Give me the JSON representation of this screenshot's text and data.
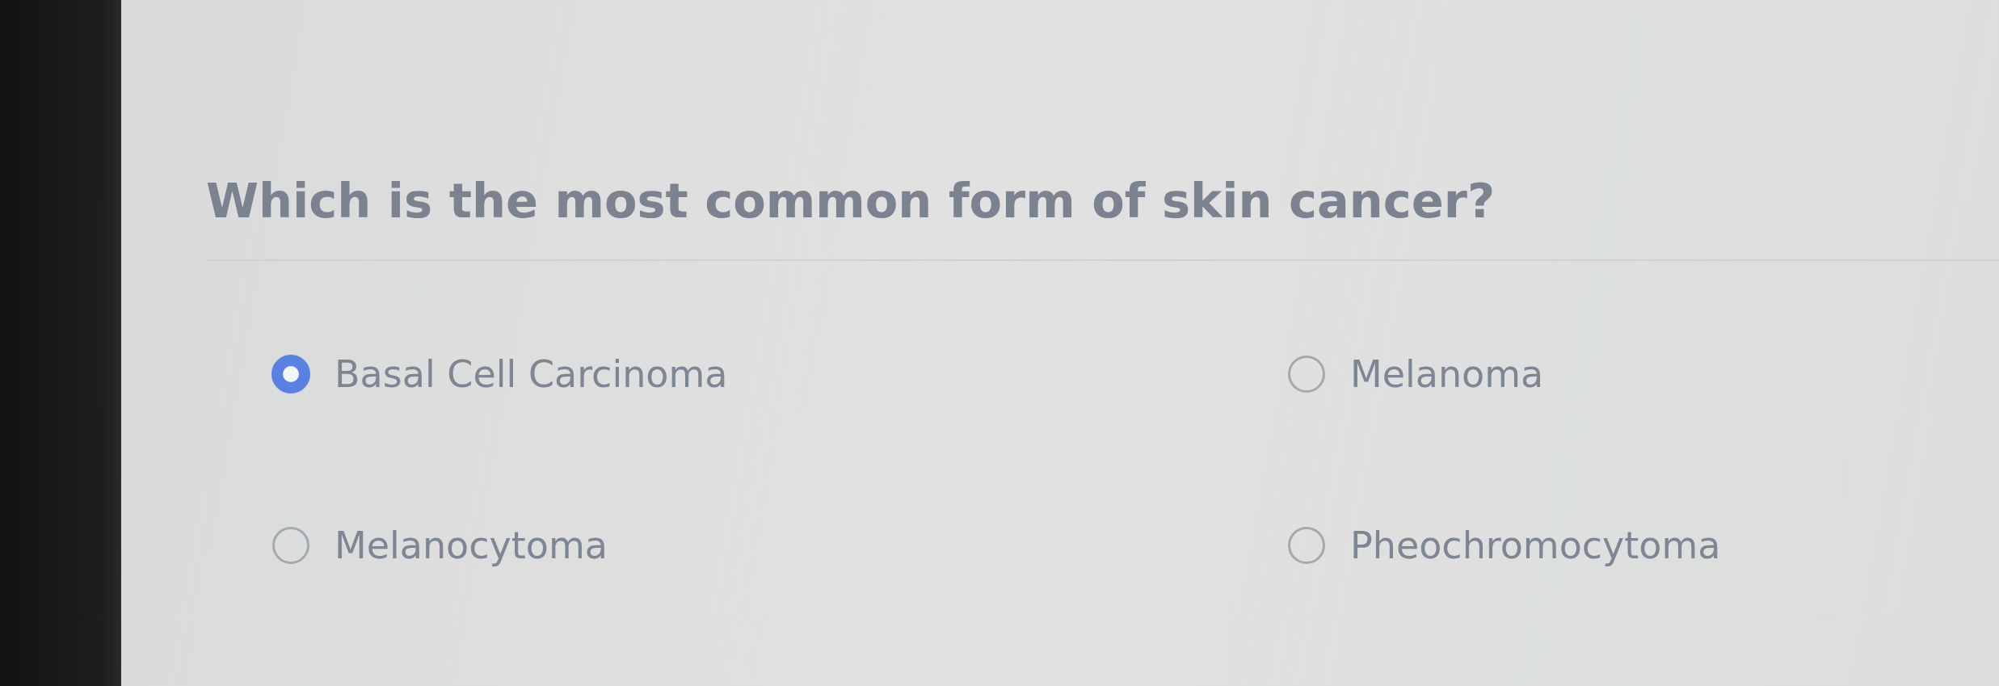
{
  "question": "Which is the most common form of skin cancer?",
  "options": [
    {
      "label": "Basal Cell Carcinoma",
      "selected": true
    },
    {
      "label": "Melanoma",
      "selected": false
    },
    {
      "label": "Melanocytoma",
      "selected": false
    },
    {
      "label": "Pheochromocytoma",
      "selected": false
    }
  ]
}
